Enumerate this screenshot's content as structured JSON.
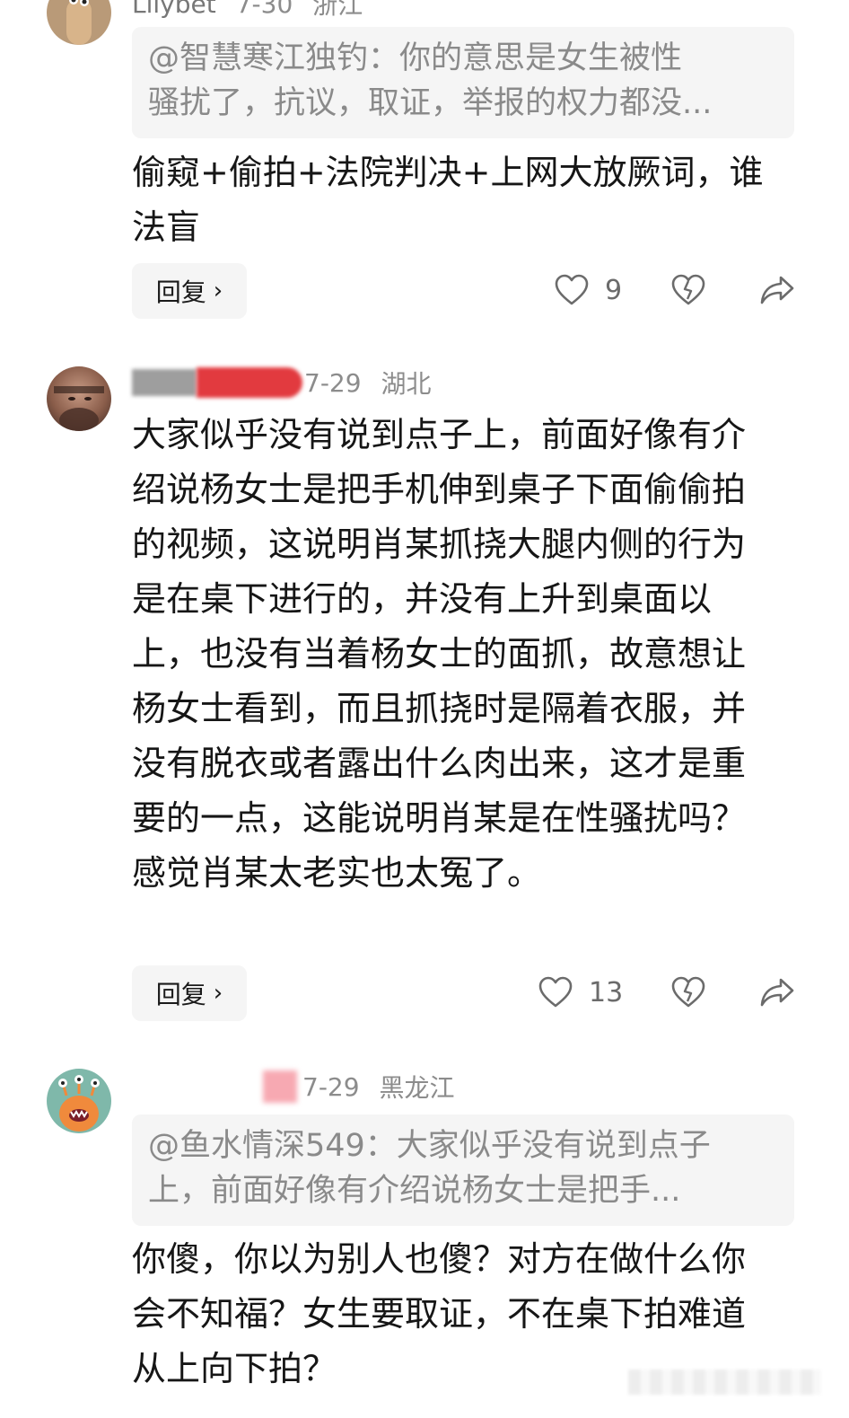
{
  "comments": [
    {
      "username_partial": "Lilybet",
      "date": "7-30",
      "location": "浙江",
      "quote_lines": [
        "@智慧寒江独钓：你的意思是女生被性",
        "骚扰了，抗议，取证，举报的权力都没..."
      ],
      "text": "偷窥+偷拍+法院判决+上网大放厥词，谁法盲",
      "reply_label": "回复",
      "likes": "9"
    },
    {
      "date": "7-29",
      "location": "湖北",
      "text": "大家似乎没有说到点子上，前面好像有介绍说杨女士是把手机伸到桌子下面偷偷拍的视频，这说明肖某抓挠大腿内侧的行为是在桌下进行的，并没有上升到桌面以上，也没有当着杨女士的面抓，故意想让杨女士看到，而且抓挠时是隔着衣服，并没有脱衣或者露出什么肉出来，这才是重要的一点，这能说明肖某是在性骚扰吗？感觉肖某太老实也太冤了。",
      "reply_label": "回复",
      "likes": "13"
    },
    {
      "date": "7-29",
      "location": "黑龙江",
      "quote_lines": [
        "@鱼水情深549：大家似乎没有说到点子",
        "上，前面好像有介绍说杨女士是把手..."
      ],
      "text": "你傻，你以为别人也傻？对方在做什么你会不知福？女生要取证，不在桌下拍难道从上向下拍？"
    }
  ],
  "colors": {
    "text": "#161616",
    "meta": "#8c8c8c",
    "quote_bg": "#f5f5f5",
    "icon": "#6b6b6b"
  },
  "icons": [
    "heart-icon",
    "dislike-icon",
    "share-icon",
    "chevron-right-icon"
  ]
}
